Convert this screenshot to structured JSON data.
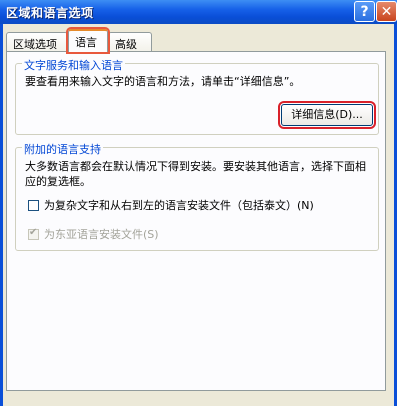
{
  "window": {
    "title": "区域和语言选项",
    "help_icon": "?",
    "close_icon": "✕",
    "help_icon_name": "help-icon",
    "close_icon_name": "close-icon"
  },
  "tabs": [
    {
      "label": "区域选项",
      "selected": false
    },
    {
      "label": "语言",
      "selected": true
    },
    {
      "label": "高级",
      "selected": false
    }
  ],
  "text_services": {
    "title": "文字服务和输入语言",
    "description": "要查看用来输入文字的语言和方法，请单击“详细信息”。",
    "details_button": "详细信息(D)..."
  },
  "supplemental": {
    "title": "附加的语言支持",
    "description": "大多数语言都会在默认情况下得到安装。要安装其他语言，选择下面相应的复选框。",
    "complex_script_label": "为复杂文字和从右到左的语言安装文件（包括泰文）(N)",
    "complex_script_checked": false,
    "east_asian_label": "为东亚语言安装文件(S)",
    "east_asian_checked": true,
    "east_asian_enabled": false,
    "checkmark_glyph": "✔"
  },
  "colors": {
    "titlebar": "#0a4fd8",
    "group_title": "#0046d5",
    "highlight_outline": "#d9212a",
    "disabled_text": "#a3a39a"
  }
}
